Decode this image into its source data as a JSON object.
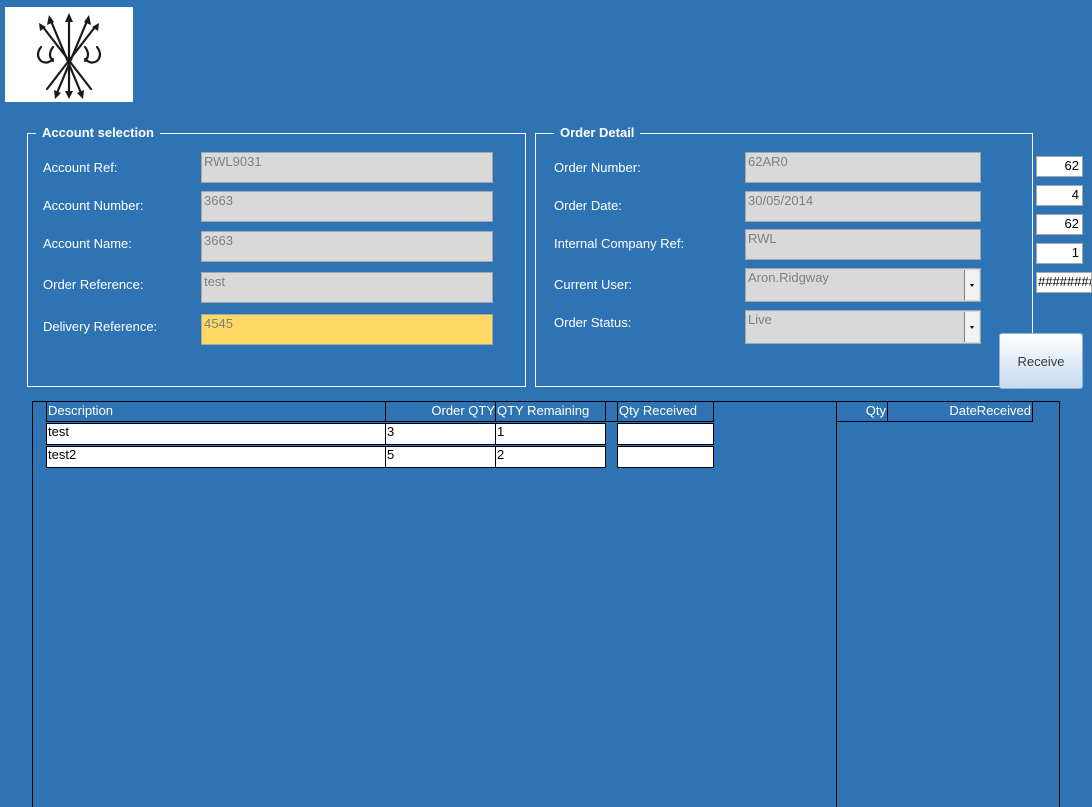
{
  "account_selection": {
    "title": "Account selection",
    "fields": [
      {
        "label": "Account Ref:",
        "value": "RWL9031"
      },
      {
        "label": "Account Number:",
        "value": "3663"
      },
      {
        "label": "Account Name:",
        "value": "3663"
      },
      {
        "label": "Order Reference:",
        "value": "test"
      },
      {
        "label": "Delivery Reference:",
        "value": "4545"
      }
    ]
  },
  "order_detail": {
    "title": "Order Detail",
    "fields": [
      {
        "label": "Order Number:",
        "value": "62AR0"
      },
      {
        "label": "Order Date:",
        "value": "30/05/2014"
      },
      {
        "label": "Internal Company Ref:",
        "value": "RWL"
      },
      {
        "label": "Current User:",
        "value": "Aron.Ridgway"
      },
      {
        "label": "Order Status:",
        "value": "Live"
      }
    ]
  },
  "side_values": [
    "62",
    "4",
    "62",
    "1",
    "########"
  ],
  "receive_button": "Receive",
  "lines_table": {
    "headers": {
      "description": "Description",
      "order_qty": "Order QTY",
      "qty_remaining": "QTY Remaining",
      "qty_received": "Qty Received"
    },
    "rows": [
      {
        "description": "test",
        "order_qty": "3",
        "qty_remaining": "1",
        "qty_received": ""
      },
      {
        "description": "test2",
        "order_qty": "5",
        "qty_remaining": "2",
        "qty_received": ""
      }
    ]
  },
  "received_table": {
    "headers": {
      "qty": "Qty",
      "date_received": "DateReceived"
    }
  }
}
